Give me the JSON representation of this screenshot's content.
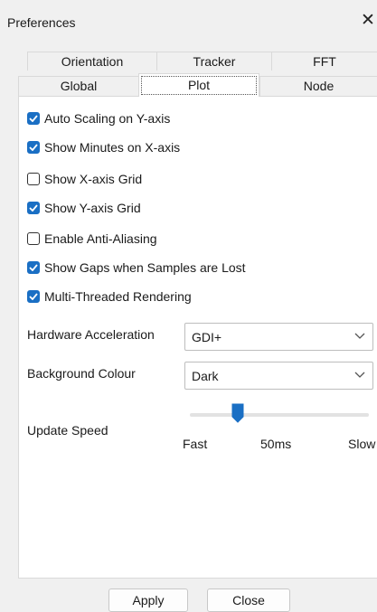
{
  "window": {
    "title": "Preferences"
  },
  "tabs": {
    "row1": [
      "Orientation",
      "Tracker",
      "FFT"
    ],
    "row2": [
      "Global",
      "Plot",
      "Node"
    ]
  },
  "options": [
    {
      "label": "Auto Scaling on Y-axis",
      "checked": true
    },
    {
      "label": "Show Minutes on X-axis",
      "checked": true
    },
    {
      "label": "Show X-axis Grid",
      "checked": false
    },
    {
      "label": "Show Y-axis Grid",
      "checked": true
    },
    {
      "label": "Enable Anti-Aliasing",
      "checked": false
    },
    {
      "label": "Show Gaps when Samples are Lost",
      "checked": true
    },
    {
      "label": "Multi-Threaded Rendering",
      "checked": true
    }
  ],
  "hardware": {
    "label": "Hardware Acceleration",
    "value": "GDI+"
  },
  "background": {
    "label": "Background Colour",
    "value": "Dark"
  },
  "speed": {
    "label": "Update Speed",
    "min_label": "Fast",
    "value_label": "50ms",
    "max_label": "Slow"
  },
  "buttons": {
    "apply": "Apply",
    "close": "Close"
  },
  "colors": {
    "accent": "#1a6fc4",
    "panel": "#ffffff",
    "dialog": "#f0f0f0"
  },
  "icons": {
    "close": "close-icon",
    "check": "check-icon",
    "dropdown": "chevron-down-icon",
    "slider": "slider-thumb"
  }
}
